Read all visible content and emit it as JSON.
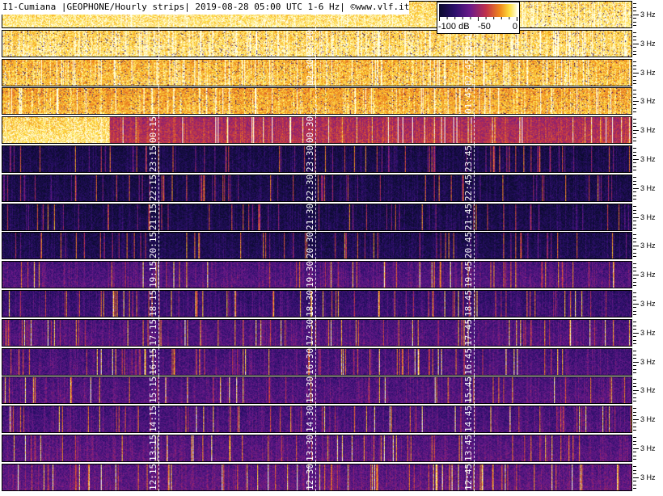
{
  "header": {
    "title": "I1-Cumiana |GEOPHONE/Hourly strips| 2019-08-28 05:00 UTC 1-6 Hz| ©www.vlf.it"
  },
  "colorbar": {
    "labels": [
      "-100 dB",
      "-50",
      "0"
    ],
    "range_db": [
      -100,
      0
    ],
    "colors": [
      "#0b0b2e",
      "#2b0f6b",
      "#6b1a8a",
      "#c0304a",
      "#f08a1c",
      "#ffe040",
      "#ffffe8"
    ]
  },
  "chart_data": {
    "type": "heatmap",
    "title": "I1-Cumiana |GEOPHONE/Hourly strips| 2019-08-28 05:00 UTC 1-6 Hz| ©www.vlf.it",
    "ylabel": "",
    "freq_range_hz": [
      1,
      6
    ],
    "hz_tick_label": "3 Hz",
    "strips": [
      {
        "time_labels": [
          "",
          "",
          "",
          ""
        ],
        "intensity": 0.92,
        "start_fraction": 0.83
      },
      {
        "time_labels": [
          "",
          "03:30",
          "",
          "03:45"
        ],
        "intensity": 0.9,
        "start_fraction": 0
      },
      {
        "time_labels": [
          "",
          "02:30",
          "",
          "02:45"
        ],
        "intensity": 0.85,
        "start_fraction": 0
      },
      {
        "time_labels": [
          "",
          "",
          "",
          "01:45"
        ],
        "intensity": 0.82,
        "start_fraction": 0
      },
      {
        "time_labels": [
          "00:15",
          "00:30",
          "",
          ""
        ],
        "intensity": 0.55,
        "start_fraction": 0.17
      },
      {
        "time_labels": [
          "23:15",
          "23:30",
          "",
          "23:45"
        ],
        "intensity": 0.08,
        "start_fraction": 0
      },
      {
        "time_labels": [
          "22:15",
          "22:30",
          "",
          "22:45"
        ],
        "intensity": 0.08,
        "start_fraction": 0
      },
      {
        "time_labels": [
          "21:15",
          "21:30",
          "",
          "21:45"
        ],
        "intensity": 0.08,
        "start_fraction": 0
      },
      {
        "time_labels": [
          "20:15",
          "20:30",
          "",
          "20:45"
        ],
        "intensity": 0.1,
        "start_fraction": 0
      },
      {
        "time_labels": [
          "19:15",
          "19:30",
          "",
          "19:45"
        ],
        "intensity": 0.3,
        "start_fraction": 0
      },
      {
        "time_labels": [
          "18:15",
          "18:30",
          "",
          "18:45"
        ],
        "intensity": 0.22,
        "start_fraction": 0
      },
      {
        "time_labels": [
          "17:15",
          "17:30",
          "",
          "17:45"
        ],
        "intensity": 0.3,
        "start_fraction": 0
      },
      {
        "time_labels": [
          "16:15",
          "16:30",
          "",
          "16:45"
        ],
        "intensity": 0.28,
        "start_fraction": 0
      },
      {
        "time_labels": [
          "15:15",
          "15:30",
          "",
          "15:45"
        ],
        "intensity": 0.3,
        "start_fraction": 0
      },
      {
        "time_labels": [
          "14:15",
          "14:30",
          "",
          "14:45"
        ],
        "intensity": 0.28,
        "start_fraction": 0
      },
      {
        "time_labels": [
          "13:15",
          "13:30",
          "",
          "13:45"
        ],
        "intensity": 0.32,
        "start_fraction": 0
      },
      {
        "time_labels": [
          "12:15",
          "12:30",
          "",
          "12:45"
        ],
        "intensity": 0.34,
        "start_fraction": 0
      }
    ]
  }
}
